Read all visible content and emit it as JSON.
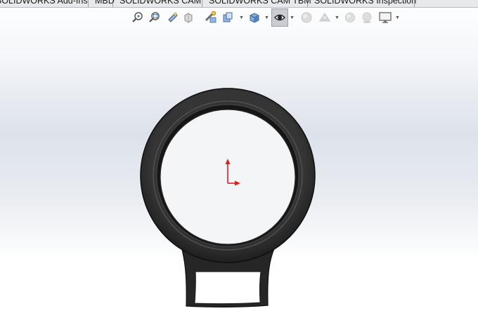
{
  "tabs": [
    {
      "label": "SOLIDWORKS Add-Ins"
    },
    {
      "label": "MBD"
    },
    {
      "label": "SOLIDWORKS CAM"
    },
    {
      "label": "SOLIDWORKS CAM TBM"
    },
    {
      "label": "SOLIDWORKS Inspection"
    }
  ],
  "view_toolbar": {
    "icons": [
      "zoom-to-fit-icon",
      "zoom-to-area-icon",
      "previous-view-icon",
      "section-view-icon",
      "dynamic-annotation-views-icon",
      "view-orientation-icon",
      "display-style-icon",
      "hide-show-items-icon",
      "edit-appearance-icon",
      "apply-scene-icon",
      "realview-graphics-icon",
      "shadows-icon",
      "view-settings-icon"
    ],
    "active": "hide-show-items-icon"
  },
  "colors": {
    "model": "#2b2b2b",
    "model_edge": "#111111",
    "origin": "#e0201c",
    "tab_bg": "#e7e9ec"
  }
}
